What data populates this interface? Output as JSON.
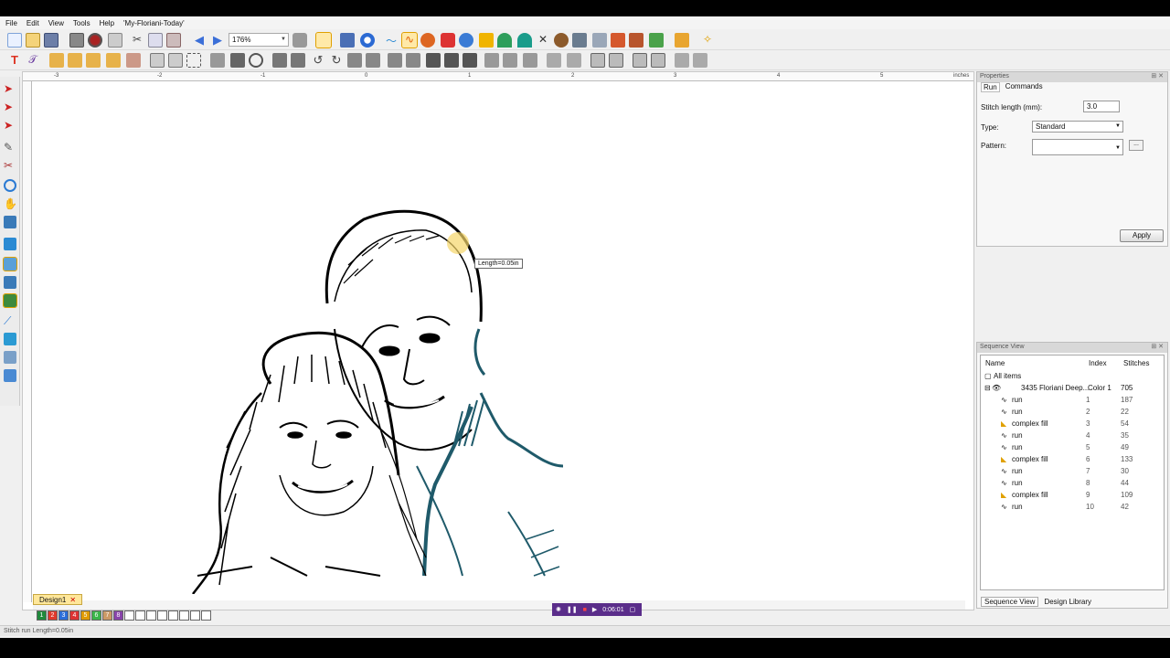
{
  "app": {
    "title": "'My-Floriani-Today'"
  },
  "menu": {
    "file": "File",
    "edit": "Edit",
    "view": "View",
    "tools": "Tools",
    "help": "Help"
  },
  "toolbar": {
    "zoom": "176%"
  },
  "ruler": {
    "unit": "inches",
    "top_ticks": [
      "-3",
      "-2",
      "-1",
      "0",
      "1",
      "2",
      "3",
      "4",
      "5"
    ]
  },
  "canvas": {
    "tooltip": "Length=0.05in"
  },
  "tabs": {
    "design": "Design1"
  },
  "colors": {
    "swatches": [
      "1",
      "2",
      "3",
      "4",
      "5",
      "6",
      "7",
      "8"
    ],
    "swatch_colors": [
      "#1f8a3c",
      "#e0392b",
      "#2a6dd8",
      "#d33",
      "#e09a00",
      "#3ab54a",
      "#c96",
      "#8844aa"
    ]
  },
  "player": {
    "time": "0:06:01"
  },
  "status": {
    "text": "Stitch run Length=0.05in"
  },
  "properties": {
    "title": "Properties",
    "tab_run": "Run",
    "tab_commands": "Commands",
    "stitch_length_label": "Stitch length (mm):",
    "stitch_length_value": "3.0",
    "type_label": "Type:",
    "type_value": "Standard",
    "pattern_label": "Pattern:",
    "pattern_value": "",
    "browse_label": "...",
    "apply": "Apply"
  },
  "sequence": {
    "title": "Sequence View",
    "col_name": "Name",
    "col_index": "Index",
    "col_stitches": "Stitches",
    "all_items": "All items",
    "group": {
      "name": "3435 Floriani Deep...",
      "index": "Color 1",
      "stitches": "705"
    },
    "rows": [
      {
        "name": "run",
        "index": "1",
        "stitches": "187"
      },
      {
        "name": "run",
        "index": "2",
        "stitches": "22"
      },
      {
        "name": "complex fill",
        "index": "3",
        "stitches": "54"
      },
      {
        "name": "run",
        "index": "4",
        "stitches": "35"
      },
      {
        "name": "run",
        "index": "5",
        "stitches": "49"
      },
      {
        "name": "complex fill",
        "index": "6",
        "stitches": "133"
      },
      {
        "name": "run",
        "index": "7",
        "stitches": "30"
      },
      {
        "name": "run",
        "index": "8",
        "stitches": "44"
      },
      {
        "name": "complex fill",
        "index": "9",
        "stitches": "109"
      },
      {
        "name": "run",
        "index": "10",
        "stitches": "42"
      }
    ],
    "footer_sequence": "Sequence View",
    "footer_library": "Design Library"
  }
}
